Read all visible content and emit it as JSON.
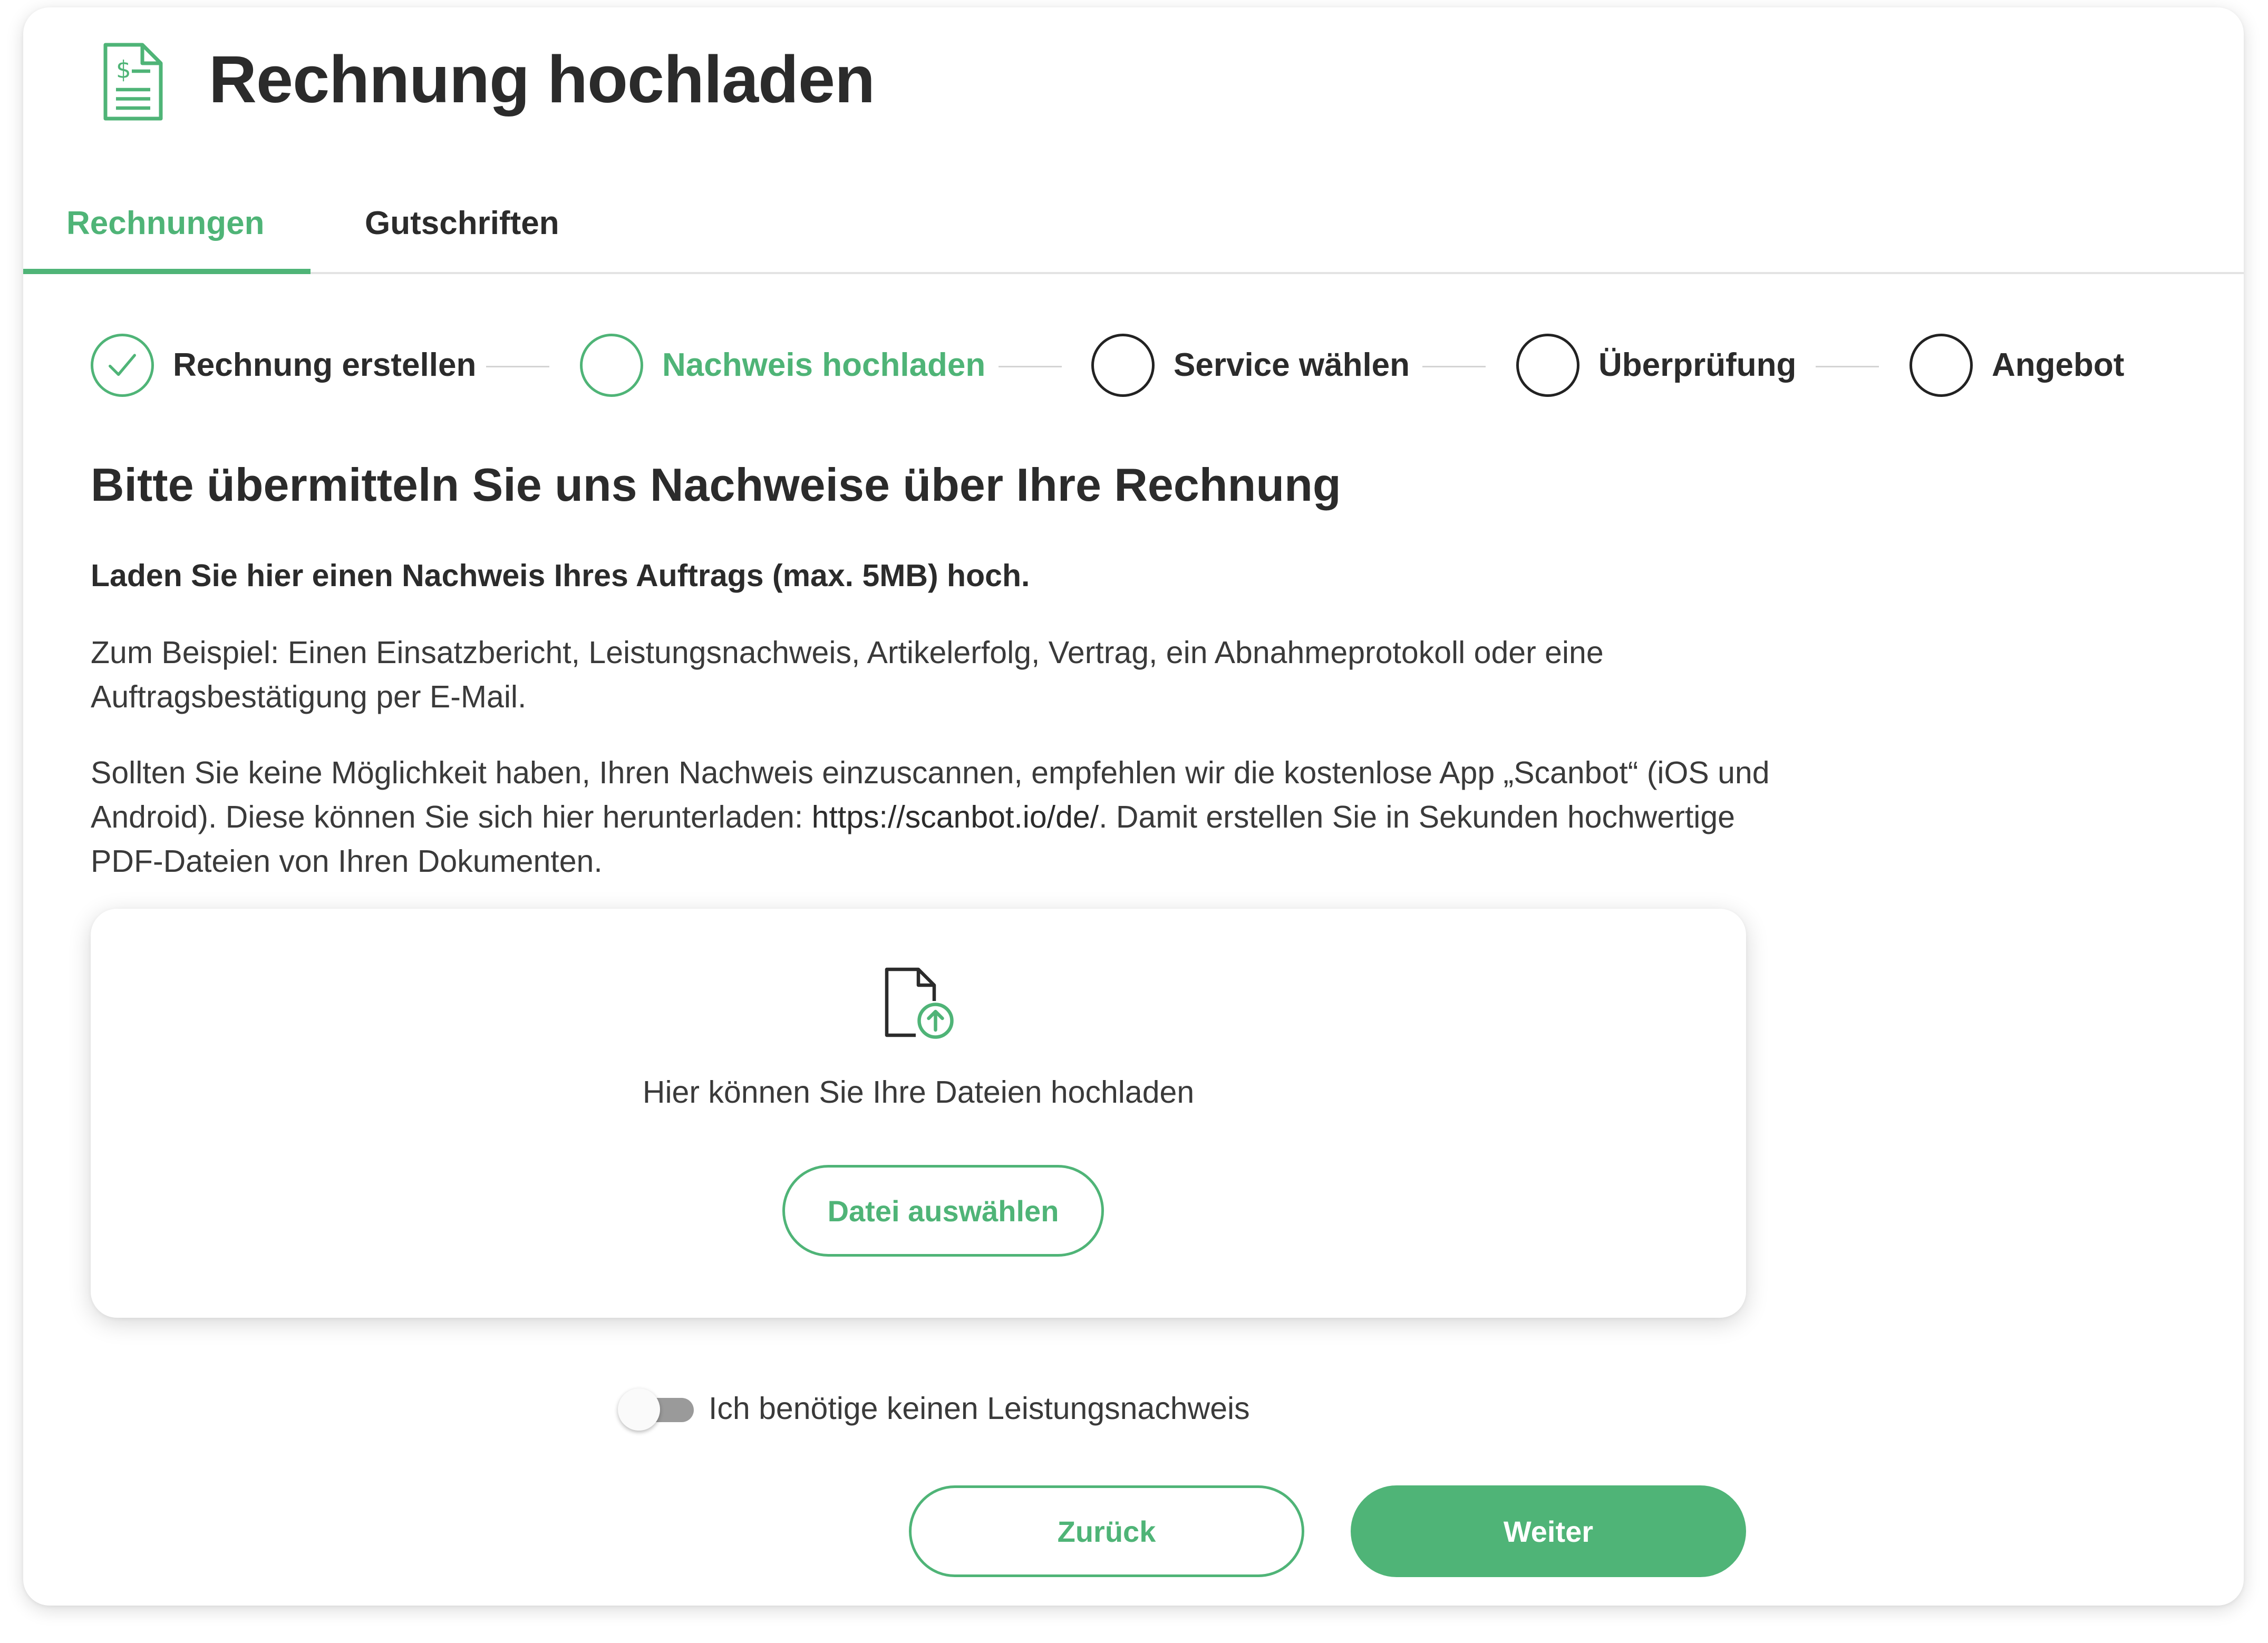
{
  "header": {
    "icon": "invoice-document-icon",
    "title": "Rechnung hochladen"
  },
  "tabs": [
    {
      "label": "Rechnungen",
      "active": true
    },
    {
      "label": "Gutschriften",
      "active": false
    }
  ],
  "steps": [
    {
      "label": "Rechnung erstellen",
      "state": "completed"
    },
    {
      "label": "Nachweis hochladen",
      "state": "current"
    },
    {
      "label": "Service wählen",
      "state": "upcoming"
    },
    {
      "label": "Überprüfung",
      "state": "upcoming"
    },
    {
      "label": "Angebot",
      "state": "upcoming"
    }
  ],
  "content": {
    "heading": "Bitte übermitteln Sie uns Nachweise über Ihre Rechnung",
    "subheading": "Laden Sie hier einen Nachweis Ihres Auftrags (max. 5MB) hoch.",
    "paragraph1": "Zum Beispiel: Einen Einsatzbericht, Leistungsnachweis, Artikelerfolg, Vertrag, ein Abnahmeprotokoll oder eine Auftragsbestätigung per E-Mail.",
    "paragraph2_before": "Sollten Sie keine Möglichkeit haben, Ihren Nachweis einzuscannen, empfehlen wir die kostenlose App „Scanbot“ (iOS und Android). Diese können Sie sich hier herunterladen: ",
    "paragraph2_link": "https://scanbot.io/de/",
    "paragraph2_after": ". Damit erstellen Sie in Sekunden hochwertige PDF-Dateien von Ihren Dokumenten."
  },
  "upload": {
    "icon": "file-upload-icon",
    "text": "Hier können Sie Ihre Dateien hochladen",
    "button_label": "Datei auswählen"
  },
  "toggle": {
    "label": "Ich benötige keinen Leistungsnachweis",
    "checked": false
  },
  "footer": {
    "back_label": "Zurück",
    "next_label": "Weiter"
  },
  "colors": {
    "accent": "#4fb477",
    "text": "#2b2b2b",
    "toggle_off": "#9a9a9a"
  }
}
